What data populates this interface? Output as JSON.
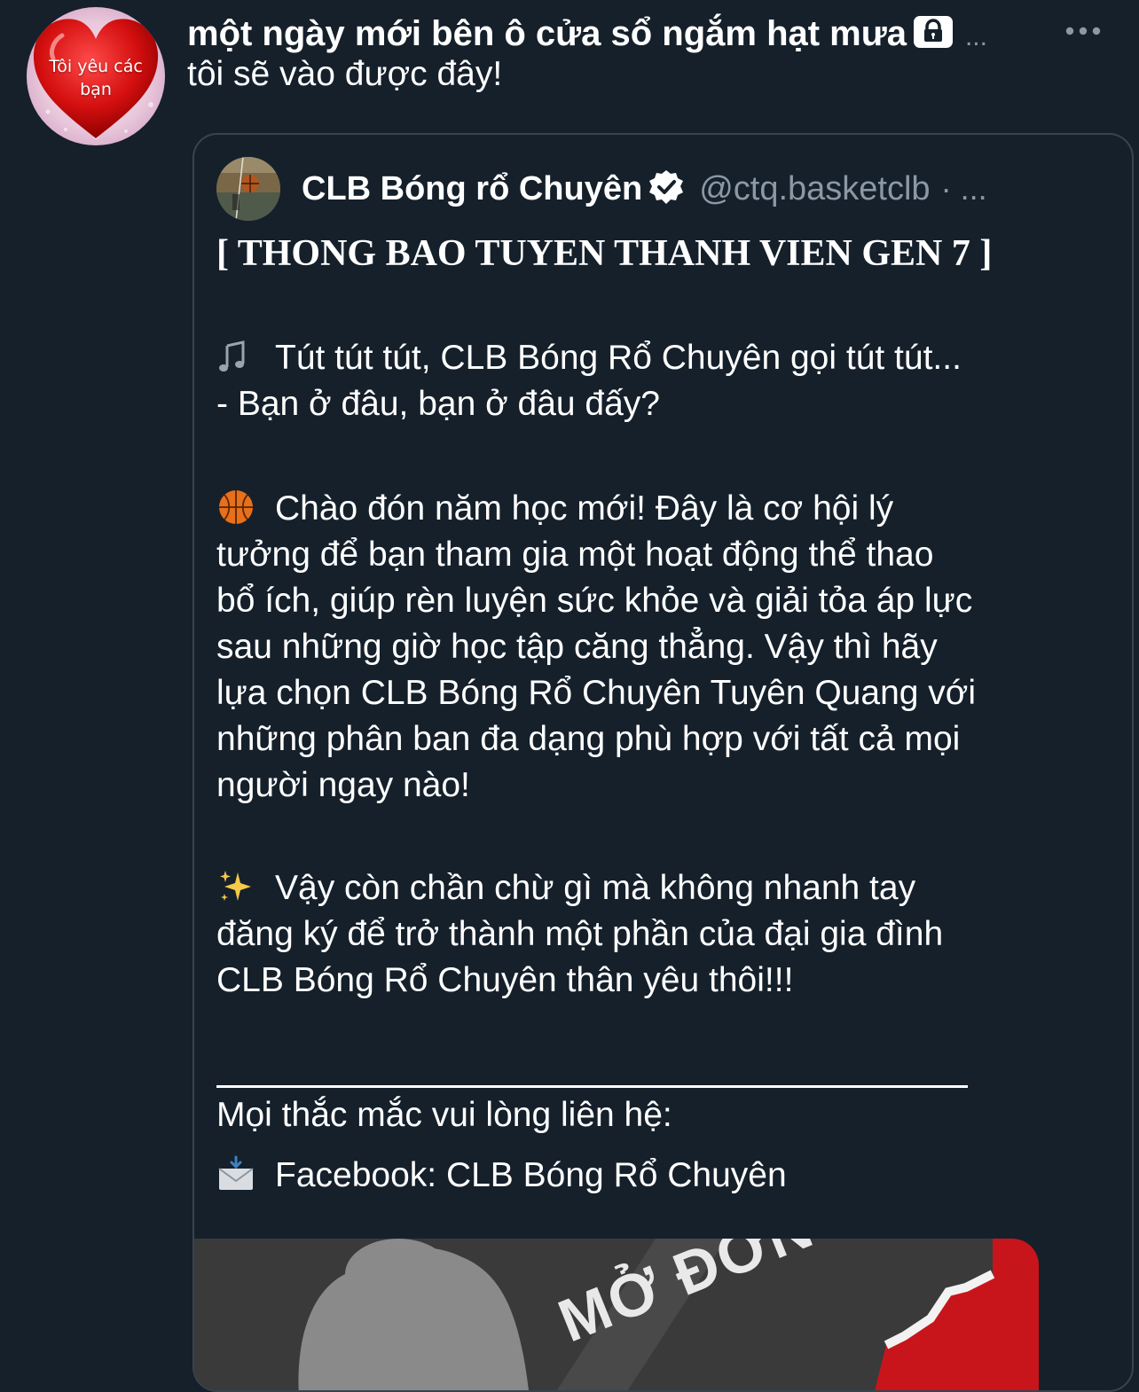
{
  "colors": {
    "background": "#15202b",
    "card_border": "#38444d",
    "text_primary": "#ffffff",
    "text_secondary": "#8b98a5",
    "verified_badge": "#ffffff",
    "image_red": "#c8151b"
  },
  "tweet": {
    "avatar_text_line1": "Tôi yêu các",
    "avatar_text_line2": "bạn",
    "display_name": "một ngày mới bên ô cửa sổ ngắm hạt mưa",
    "name_truncation": "...",
    "protected_icon": "lock-icon",
    "more_icon": "more-horizontal-icon",
    "text": "tôi sẽ vào được đây!"
  },
  "quoted": {
    "avatar_icon": "basketball-court-avatar",
    "name": "CLB Bóng rổ Chuyên",
    "verified_icon": "verified-badge-icon",
    "handle": "@ctq.basketclb",
    "separator": "·",
    "truncation": "...",
    "title": "[ THONG BAO TUYEN THANH VIEN GEN 7 ]",
    "para1": {
      "emoji": "musical-notes-icon",
      "line1": "Tút tút tút, CLB Bóng Rổ Chuyên gọi tút tút...",
      "line2": "- Bạn ở đâu, bạn ở đâu đấy?"
    },
    "para2": {
      "emoji": "basketball-icon",
      "lines": [
        "Chào đón năm học mới! Đây là cơ hội lý",
        "tưởng để bạn tham gia một hoạt động thể thao",
        "bổ ích, giúp rèn luyện sức khỏe và giải tỏa áp lực",
        "sau những giờ học tập căng thẳng. Vậy thì hãy",
        "lựa chọn CLB Bóng Rổ Chuyên Tuyên Quang với",
        "những phân ban đa dạng phù hợp với tất cả mọi",
        "người ngay nào!"
      ]
    },
    "para3": {
      "emoji": "sparkles-icon",
      "lines": [
        "Vậy còn chần chừ gì mà không nhanh tay",
        "đăng ký để trở thành một phần của đại gia đình",
        "CLB Bóng Rổ Chuyên thân yêu thôi!!!"
      ]
    },
    "contact_label": "Mọi thắc mắc vui lòng liên hệ:",
    "contact": {
      "emoji": "incoming-envelope-icon",
      "text": "Facebook: CLB Bóng Rổ Chuyên"
    },
    "image": {
      "text": "MỞ ĐƠN"
    }
  }
}
